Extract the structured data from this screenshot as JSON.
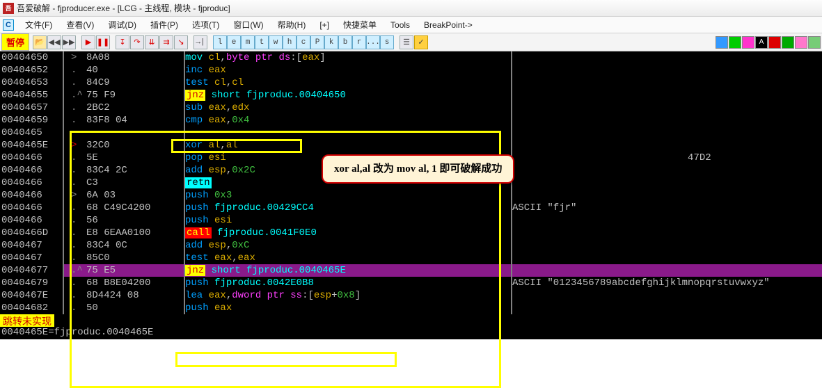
{
  "title": "吾爱破解 - fjproducer.exe - [LCG -  主线程, 模块 - fjproduc]",
  "menubar": [
    "文件(F)",
    "查看(V)",
    "调试(D)",
    "插件(P)",
    "选项(T)",
    "窗口(W)",
    "帮助(H)",
    "[+]",
    "快捷菜单",
    "Tools",
    "BreakPoint->"
  ],
  "status_pause": "暂停",
  "letters": [
    "l",
    "e",
    "m",
    "t",
    "w",
    "h",
    "c",
    "P",
    "k",
    "b",
    "r",
    "...",
    "s"
  ],
  "callout_text": "xor al,al 改为 mov al, 1 即可破解成功",
  "footer1": "跳转未实现",
  "footer2": "0040465E=fjproduc.0040465E",
  "rows": [
    {
      "addr": "00404650",
      "gut": "",
      "mk": ">",
      "hex": "8A08",
      "inst": [
        [
          "op-mov",
          "mov "
        ],
        [
          "reg",
          "cl"
        ],
        [
          "",
          ","
        ],
        [
          "kw",
          "byte ptr "
        ],
        [
          "seg",
          "ds"
        ],
        [
          "",
          ":["
        ],
        [
          "reg",
          "eax"
        ],
        [
          "",
          "]"
        ]
      ]
    },
    {
      "addr": "00404652",
      "gut": "",
      "mk": ".",
      "hex": "40",
      "inst": [
        [
          "op-generic",
          "inc "
        ],
        [
          "reg",
          "eax"
        ]
      ]
    },
    {
      "addr": "00404653",
      "gut": "",
      "mk": ".",
      "hex": "84C9",
      "inst": [
        [
          "op-generic",
          "test "
        ],
        [
          "reg",
          "cl"
        ],
        [
          "",
          ","
        ],
        [
          "reg",
          "cl"
        ]
      ]
    },
    {
      "addr": "00404655",
      "gut": "",
      "mk": ".^",
      "hex": "75 F9",
      "inst": [
        [
          "op-jnz",
          "jnz"
        ],
        [
          "",
          " "
        ],
        [
          "tok",
          "short fjproduc.00404650"
        ]
      ]
    },
    {
      "addr": "00404657",
      "gut": "",
      "mk": ".",
      "hex": "2BC2",
      "inst": [
        [
          "op-generic",
          "sub "
        ],
        [
          "reg",
          "eax"
        ],
        [
          "",
          ","
        ],
        [
          "reg",
          "edx"
        ]
      ]
    },
    {
      "addr": "00404659",
      "gut": "",
      "mk": ".",
      "hex": "83F8 04",
      "inst": [
        [
          "op-generic",
          "cmp "
        ],
        [
          "reg",
          "eax"
        ],
        [
          "",
          ","
        ],
        [
          "num",
          "0x4"
        ]
      ]
    },
    {
      "addr": "0040465",
      "gut": "",
      "mk": "",
      "hex": "",
      "inst": [
        [
          "",
          ""
        ]
      ],
      "obsc": true
    },
    {
      "addr": "0040465E",
      "gut": "",
      "mk": "> ",
      "hex": "32C0",
      "inst": [
        [
          "op-generic",
          "xor "
        ],
        [
          "reg",
          "al"
        ],
        [
          "",
          ","
        ],
        [
          "reg",
          "al"
        ]
      ],
      "hasarrow": true
    },
    {
      "addr": "0040466",
      "gut": "",
      "mk": ".",
      "hex": "5E",
      "inst": [
        [
          "op-generic",
          "pop "
        ],
        [
          "reg",
          "esi"
        ]
      ],
      "cmt": "                              47D2"
    },
    {
      "addr": "0040466",
      "gut": "",
      "mk": ".",
      "hex": "83C4 2C",
      "inst": [
        [
          "op-generic",
          "add "
        ],
        [
          "reg",
          "esp"
        ],
        [
          "",
          ","
        ],
        [
          "num",
          "0x2C"
        ]
      ]
    },
    {
      "addr": "0040466",
      "gut": "",
      "mk": ".",
      "hex": "C3",
      "inst": [
        [
          "op-retn",
          "retn"
        ]
      ]
    },
    {
      "addr": "0040466",
      "gut": "",
      "mk": ">",
      "hex": "6A 03",
      "inst": [
        [
          "op-generic",
          "push "
        ],
        [
          "num",
          "0x3"
        ]
      ]
    },
    {
      "addr": "0040466",
      "gut": "",
      "mk": ".",
      "hex": "68 C49C4200",
      "inst": [
        [
          "op-generic",
          "push "
        ],
        [
          "tok",
          "fjproduc.00429CC4"
        ]
      ],
      "cmt": "ASCII \"fjr\""
    },
    {
      "addr": "0040466",
      "gut": "",
      "mk": ".",
      "hex": "56",
      "inst": [
        [
          "op-generic",
          "push "
        ],
        [
          "reg",
          "esi"
        ]
      ]
    },
    {
      "addr": "0040466D",
      "gut": "",
      "mk": ".",
      "hex": "E8 6EAA0100",
      "inst": [
        [
          "op-call",
          "call"
        ],
        [
          "",
          " "
        ],
        [
          "tok",
          "fjproduc.0041F0E0"
        ]
      ]
    },
    {
      "addr": "0040467",
      "gut": "",
      "mk": ".",
      "hex": "83C4 0C",
      "inst": [
        [
          "op-generic",
          "add "
        ],
        [
          "reg",
          "esp"
        ],
        [
          "",
          ","
        ],
        [
          "num",
          "0xC"
        ]
      ]
    },
    {
      "addr": "0040467",
      "gut": "",
      "mk": ".",
      "hex": "85C0",
      "inst": [
        [
          "op-generic",
          "test "
        ],
        [
          "reg",
          "eax"
        ],
        [
          "",
          ","
        ],
        [
          "reg",
          "eax"
        ]
      ]
    },
    {
      "addr": "00404677",
      "gut": "",
      "mk": ".^",
      "hex": "75 E5",
      "inst": [
        [
          "op-jnz",
          "jnz"
        ],
        [
          "",
          " "
        ],
        [
          "tok",
          "short fjproduc.0040465E"
        ]
      ],
      "sel": true
    },
    {
      "addr": "00404679",
      "gut": "",
      "mk": ".",
      "hex": "68 B8E04200",
      "inst": [
        [
          "op-generic",
          "push "
        ],
        [
          "tok",
          "fjproduc.0042E0B8"
        ]
      ],
      "cmt": "ASCII \"0123456789abcdefghijklmnopqrstuvwxyz\""
    },
    {
      "addr": "0040467E",
      "gut": "",
      "mk": ".",
      "hex": "8D4424 08",
      "inst": [
        [
          "op-generic",
          "lea "
        ],
        [
          "reg",
          "eax"
        ],
        [
          "",
          ","
        ],
        [
          "kw",
          "dword ptr "
        ],
        [
          "seg",
          "ss"
        ],
        [
          "",
          ":["
        ],
        [
          "reg",
          "esp"
        ],
        [
          "",
          "+"
        ],
        [
          "num",
          "0x8"
        ],
        [
          "",
          "]"
        ]
      ]
    },
    {
      "addr": "00404682",
      "gut": "",
      "mk": ".",
      "hex": "50",
      "inst": [
        [
          "op-generic",
          "push "
        ],
        [
          "reg",
          "eax"
        ]
      ]
    }
  ]
}
